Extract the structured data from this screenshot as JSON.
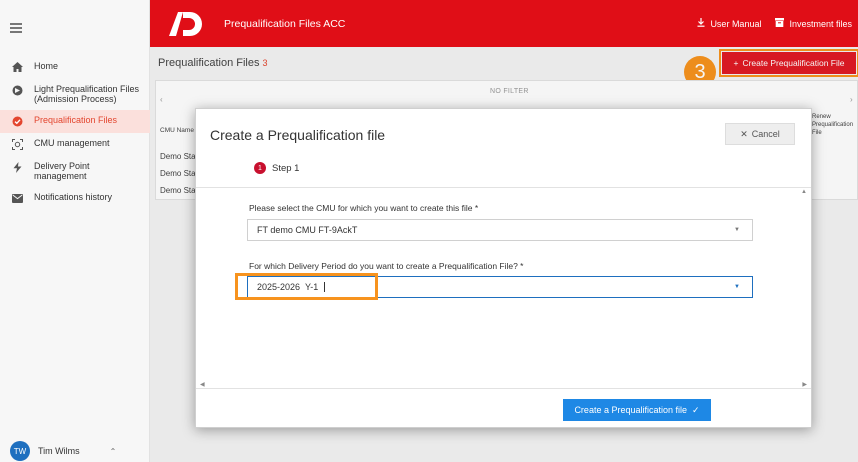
{
  "header": {
    "app_title": "Prequalification Files ACC",
    "user_manual": "User Manual",
    "investment_files": "Investment files",
    "brand_color": "#e00e17"
  },
  "sidebar": {
    "items": [
      {
        "label": "Home",
        "icon": "home-icon"
      },
      {
        "label": "Light Prequalification Files (Admission Process)",
        "icon": "admission-icon"
      },
      {
        "label": "Prequalification Files",
        "icon": "check-circle-icon",
        "active": true
      },
      {
        "label": "CMU management",
        "icon": "target-icon"
      },
      {
        "label": "Delivery Point management",
        "icon": "bolt-icon"
      },
      {
        "label": "Notifications history",
        "icon": "mail-icon"
      }
    ],
    "user": {
      "initials": "TW",
      "name": "Tim Wilms"
    }
  },
  "page": {
    "title": "Prequalification Files",
    "count": "3",
    "create_button": "Create Prequalification File",
    "callout_number": "3",
    "no_filter": "NO FILTER",
    "col_cmu": "CMU Name",
    "col_renew": "Renew Prequalification File",
    "rows": [
      "Demo Sta",
      "Demo Sta",
      "Demo Sta"
    ]
  },
  "modal": {
    "title": "Create a Prequalification file",
    "cancel": "Cancel",
    "step_number": "1",
    "step_label": "Step 1",
    "cmu_label": "Please select the CMU for which you want to create this file *",
    "cmu_value": "FT demo CMU FT-9AckT",
    "period_label": "For which Delivery Period do you want to create a Prequalification File? *",
    "period_value": "2025-2026",
    "period_tag": "Y-1",
    "submit": "Create a Prequalification file"
  }
}
